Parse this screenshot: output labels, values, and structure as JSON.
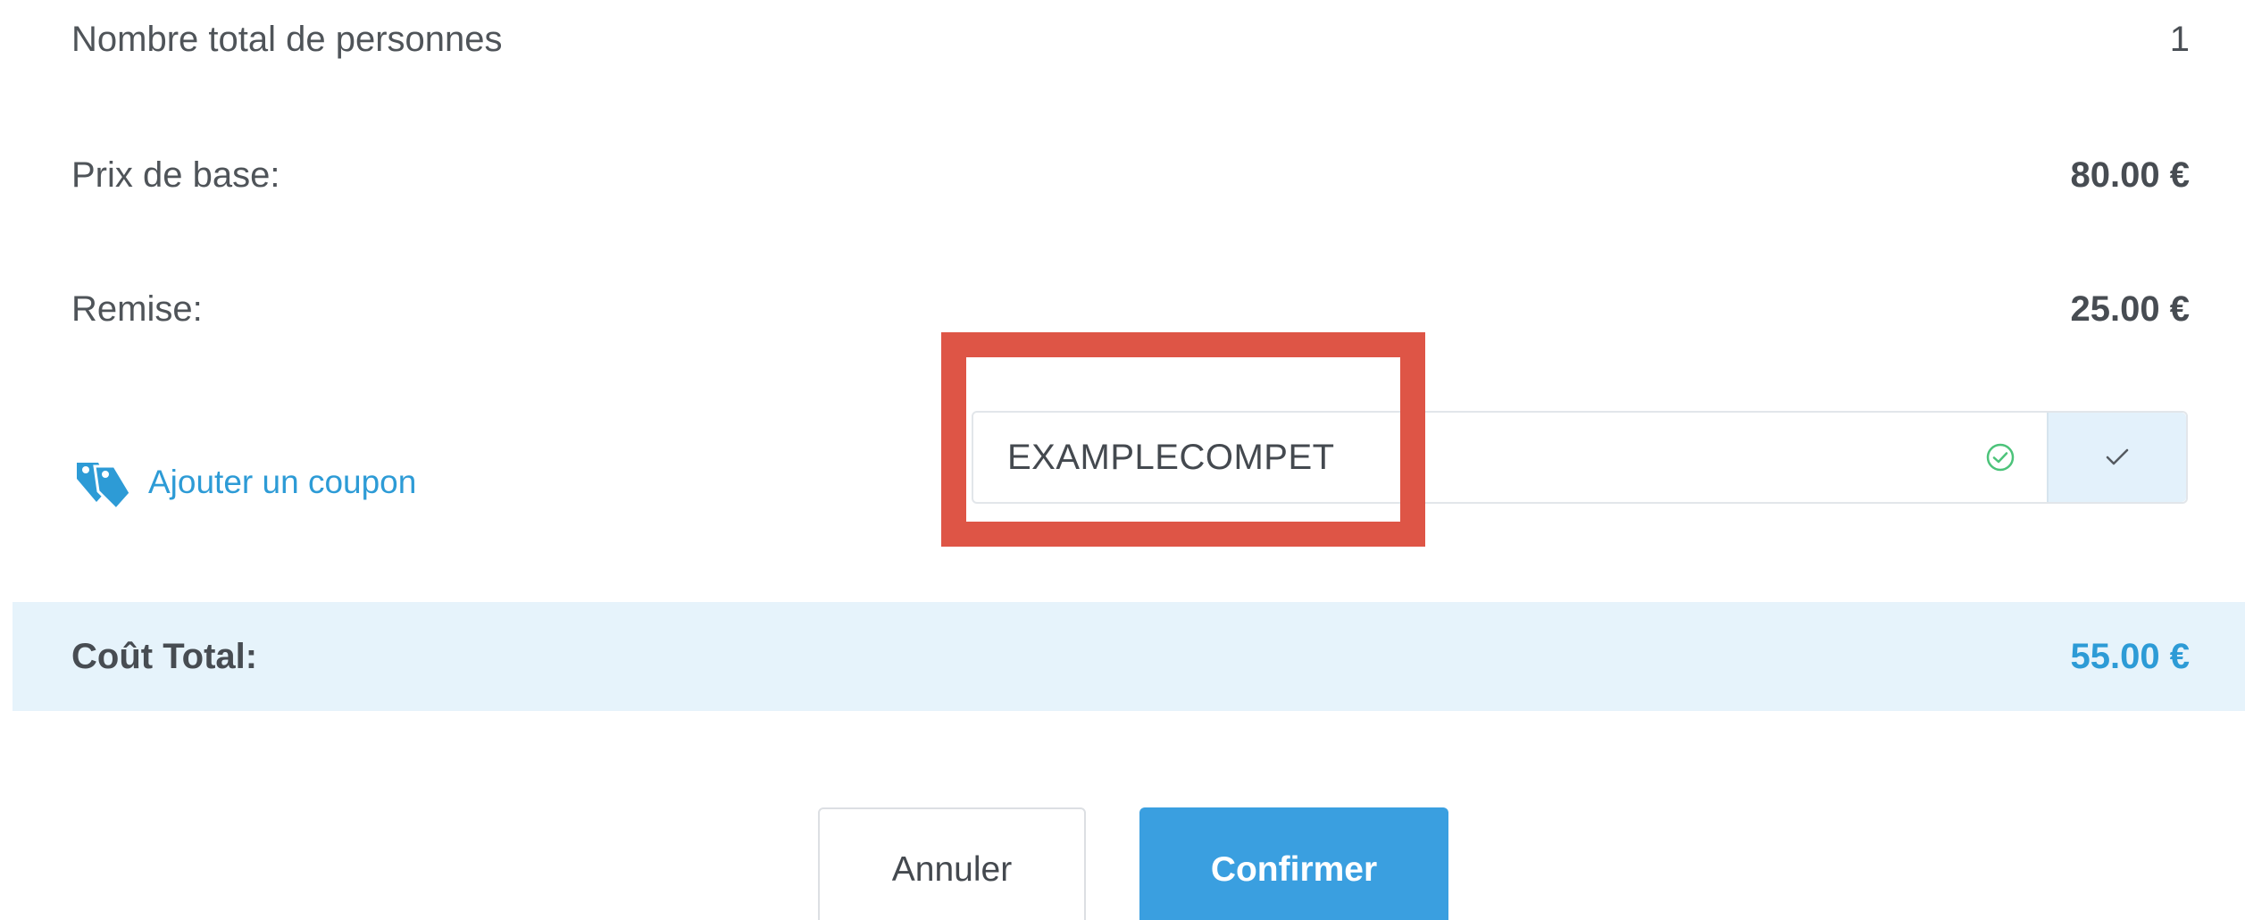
{
  "summary": {
    "persons_label": "Nombre total de personnes",
    "persons_value": "1",
    "base_price_label": "Prix de base:",
    "base_price_value": "80.00 €",
    "discount_label": "Remise:",
    "discount_value": "25.00 €"
  },
  "coupon": {
    "link_label": "Ajouter un coupon",
    "input_value": "EXAMPLECOMPET",
    "icon": "coupon-tags-icon",
    "valid_icon": "check-circle-icon",
    "apply_icon": "checkmark-icon"
  },
  "total": {
    "label": "Coût Total:",
    "value": "55.00 €"
  },
  "actions": {
    "cancel_label": "Annuler",
    "confirm_label": "Confirmer"
  },
  "colors": {
    "accent": "#2d9bd6",
    "confirm_button": "#3a9fe0",
    "total_bar": "#e6f3fb",
    "highlight": "#de5546",
    "valid_green": "#4cc37a"
  }
}
